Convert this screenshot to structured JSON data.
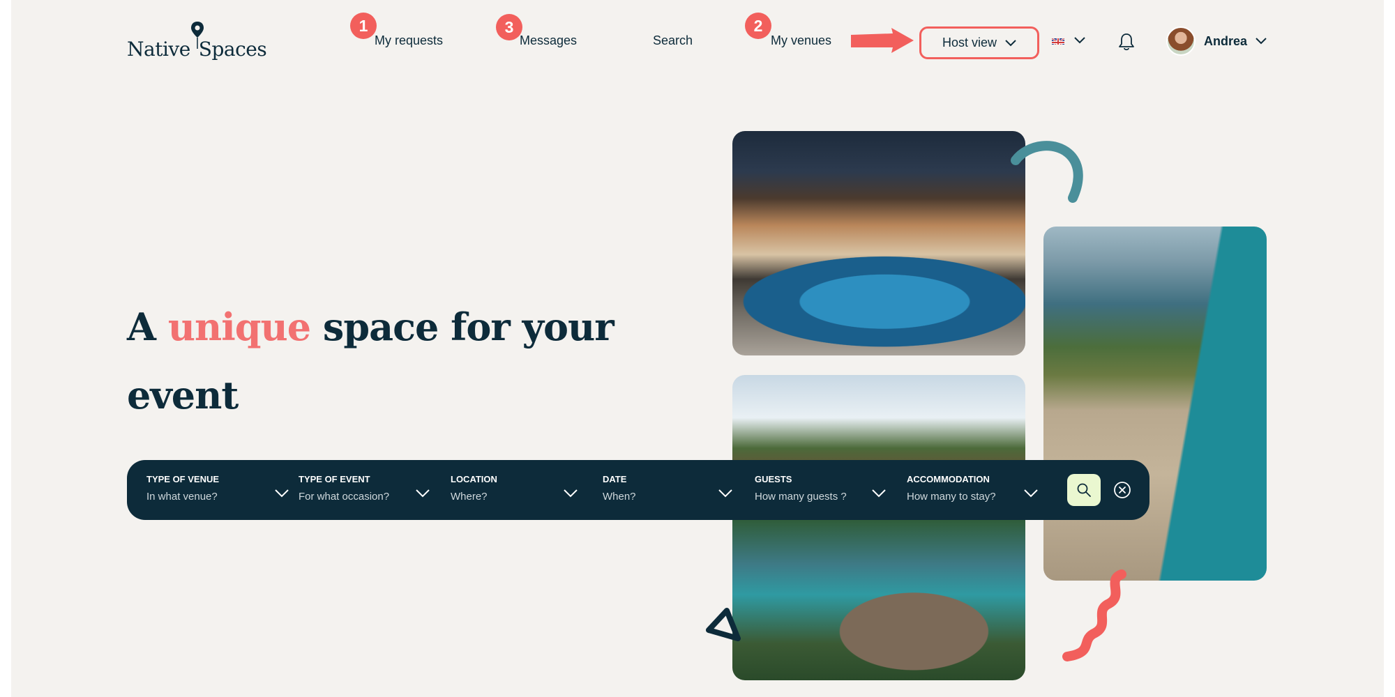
{
  "brand": {
    "logo_word1": "Native",
    "logo_word2": "Spaces"
  },
  "nav": {
    "items": [
      {
        "label": "My requests",
        "badge": "1"
      },
      {
        "label": "Messages",
        "badge": "3"
      },
      {
        "label": "Search",
        "badge": null
      },
      {
        "label": "My venues",
        "badge": "2"
      }
    ],
    "host_view_label": "Host view",
    "language_icon": "flag-uk-icon",
    "user_name": "Andrea"
  },
  "hero": {
    "title_before": "A ",
    "title_accent": "unique",
    "title_after": " space for your event"
  },
  "search": {
    "fields": [
      {
        "label": "TYPE OF VENUE",
        "value": "In what venue?"
      },
      {
        "label": "TYPE OF EVENT",
        "value": "For what occasion?"
      },
      {
        "label": "LOCATION",
        "value": "Where?"
      },
      {
        "label": "DATE",
        "value": "When?"
      },
      {
        "label": "GUESTS",
        "value": "How many guests ?"
      },
      {
        "label": "ACCOMMODATION",
        "value": "How many to stay?"
      }
    ],
    "search_icon": "search-icon",
    "clear_icon": "close-circle-icon"
  },
  "colors": {
    "navy": "#0d2b3a",
    "accent": "#f25f5c",
    "background": "#f4f2ef",
    "search_button": "#eaf7d0",
    "teal": "#4a8f9a"
  }
}
